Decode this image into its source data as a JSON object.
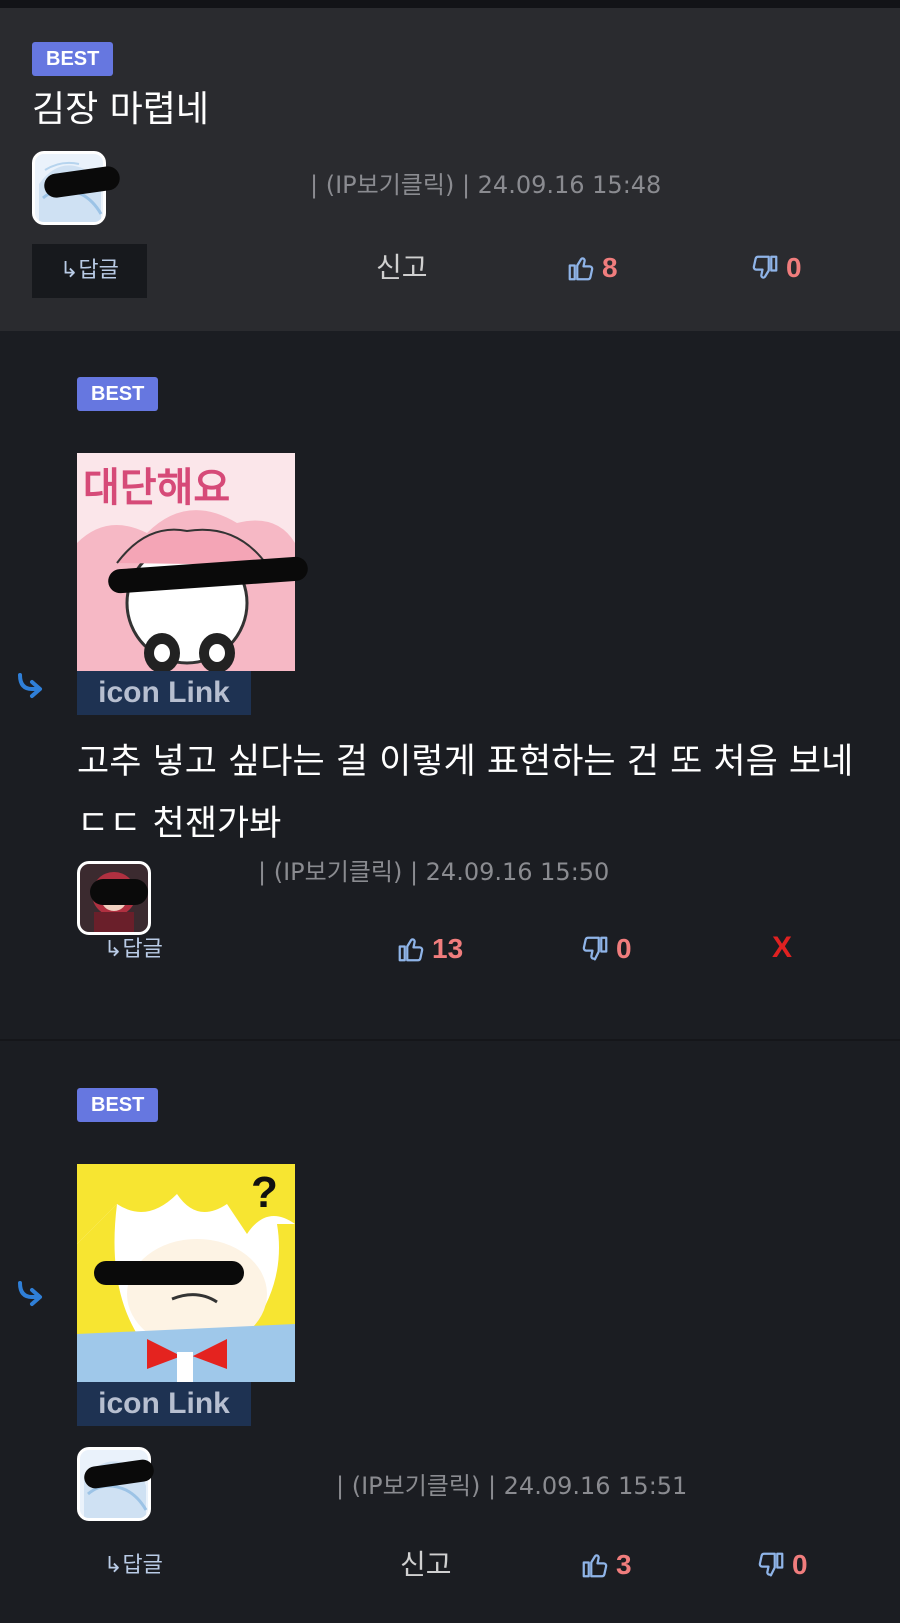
{
  "comments": [
    {
      "badge": "BEST",
      "title": "김장 마렵네",
      "meta": "| (IP보기클릭) | 24.09.16 15:48",
      "reply_label": "↳답글",
      "report_label": "신고",
      "likes": "8",
      "dislikes": "0"
    },
    {
      "badge": "BEST",
      "sticker_text": "대단해요",
      "icon_link": "icon Link",
      "body": "고추 넣고 싶다는 걸 이렇게 표현하는 건 또 처음 보네 ㄷㄷ 천잰가봐",
      "meta": "| (IP보기클릭) | 24.09.16 15:50",
      "reply_label": "↳답글",
      "likes": "13",
      "dislikes": "0",
      "delete_label": "X"
    },
    {
      "badge": "BEST",
      "sticker_text": "?",
      "icon_link": "icon Link",
      "meta": "| (IP보기클릭) | 24.09.16 15:51",
      "reply_label": "↳답글",
      "report_label": "신고",
      "likes": "3",
      "dislikes": "0"
    }
  ],
  "icons": {
    "like": "thumbs-up-icon",
    "dislike": "thumbs-down-icon",
    "reply_arrow": "reply-arrow-icon"
  },
  "colors": {
    "badge": "#6677e0",
    "vote_count": "#f07d7d",
    "delete": "#e02121",
    "reply_arrow": "#2f7fd8",
    "icon_link_bg": "#1e3252"
  }
}
